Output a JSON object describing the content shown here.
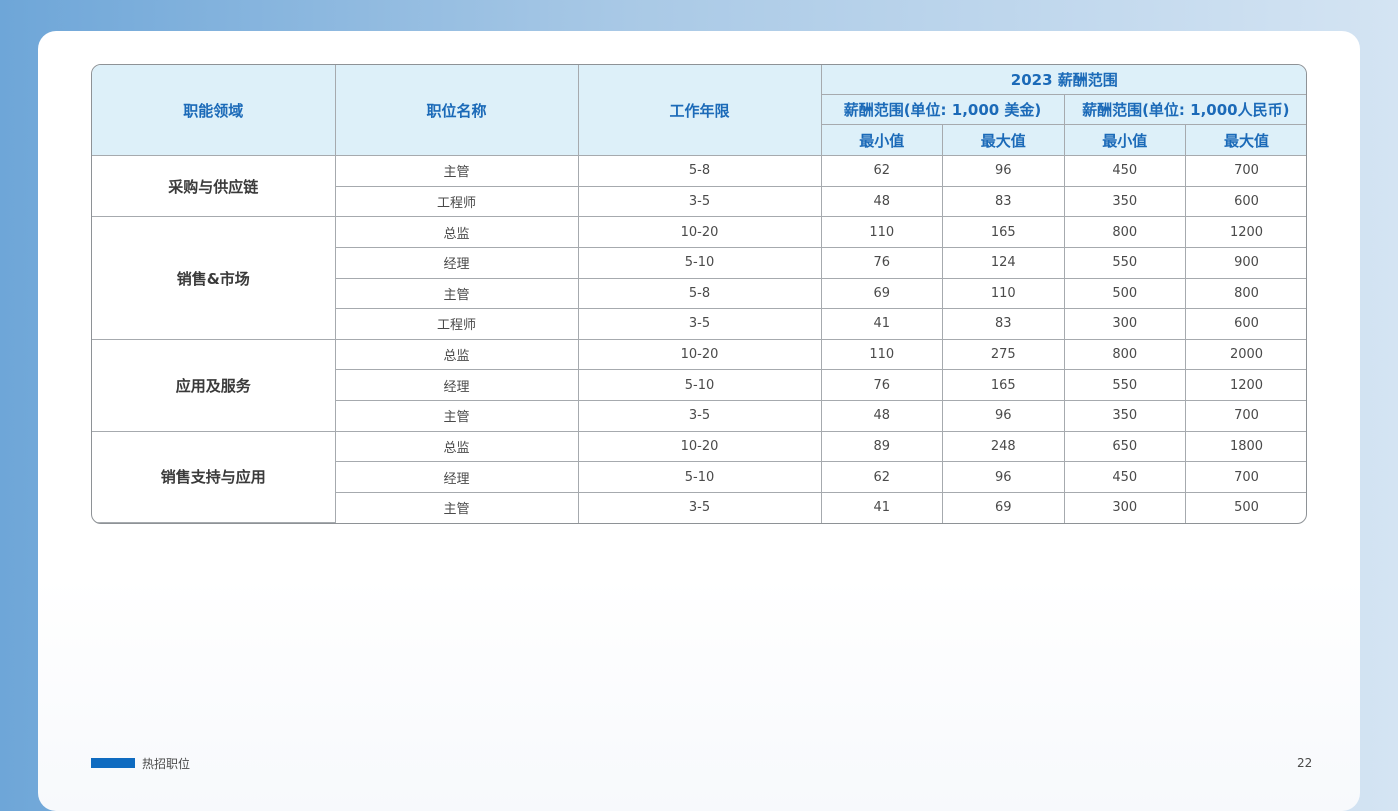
{
  "table": {
    "header": {
      "col_function": "职能领域",
      "col_position": "职位名称",
      "col_years": "工作年限",
      "salary_group": "2023 薪酬范围",
      "usd_group": "薪酬范围(单位: 1,000 美金)",
      "rmb_group": "薪酬范围(单位: 1,000人民币)",
      "min": "最小值",
      "max": "最大值"
    },
    "groups": [
      {
        "name": "采购与供应链",
        "rows": [
          {
            "position": "主管",
            "years": "5-8",
            "usd_min": "62",
            "usd_max": "96",
            "rmb_min": "450",
            "rmb_max": "700"
          },
          {
            "position": "工程师",
            "years": "3-5",
            "usd_min": "48",
            "usd_max": "83",
            "rmb_min": "350",
            "rmb_max": "600"
          }
        ]
      },
      {
        "name": "销售&市场",
        "rows": [
          {
            "position": "总监",
            "years": "10-20",
            "usd_min": "110",
            "usd_max": "165",
            "rmb_min": "800",
            "rmb_max": "1200"
          },
          {
            "position": "经理",
            "years": "5-10",
            "usd_min": "76",
            "usd_max": "124",
            "rmb_min": "550",
            "rmb_max": "900"
          },
          {
            "position": "主管",
            "years": "5-8",
            "usd_min": "69",
            "usd_max": "110",
            "rmb_min": "500",
            "rmb_max": "800"
          },
          {
            "position": "工程师",
            "years": "3-5",
            "usd_min": "41",
            "usd_max": "83",
            "rmb_min": "300",
            "rmb_max": "600"
          }
        ]
      },
      {
        "name": "应用及服务",
        "rows": [
          {
            "position": "总监",
            "years": "10-20",
            "usd_min": "110",
            "usd_max": "275",
            "rmb_min": "800",
            "rmb_max": "2000"
          },
          {
            "position": "经理",
            "years": "5-10",
            "usd_min": "76",
            "usd_max": "165",
            "rmb_min": "550",
            "rmb_max": "1200"
          },
          {
            "position": "主管",
            "years": "3-5",
            "usd_min": "48",
            "usd_max": "96",
            "rmb_min": "350",
            "rmb_max": "700"
          }
        ]
      },
      {
        "name": "销售支持与应用",
        "rows": [
          {
            "position": "总监",
            "years": "10-20",
            "usd_min": "89",
            "usd_max": "248",
            "rmb_min": "650",
            "rmb_max": "1800"
          },
          {
            "position": "经理",
            "years": "5-10",
            "usd_min": "62",
            "usd_max": "96",
            "rmb_min": "450",
            "rmb_max": "700"
          },
          {
            "position": "主管",
            "years": "3-5",
            "usd_min": "41",
            "usd_max": "69",
            "rmb_min": "300",
            "rmb_max": "500"
          }
        ]
      }
    ]
  },
  "footer": {
    "section_label": "热招职位",
    "page_number": "22"
  },
  "colors": {
    "header_bg": "#ddf0f9",
    "header_text": "#1b6ab8",
    "accent_bar": "#0f6bc0"
  }
}
